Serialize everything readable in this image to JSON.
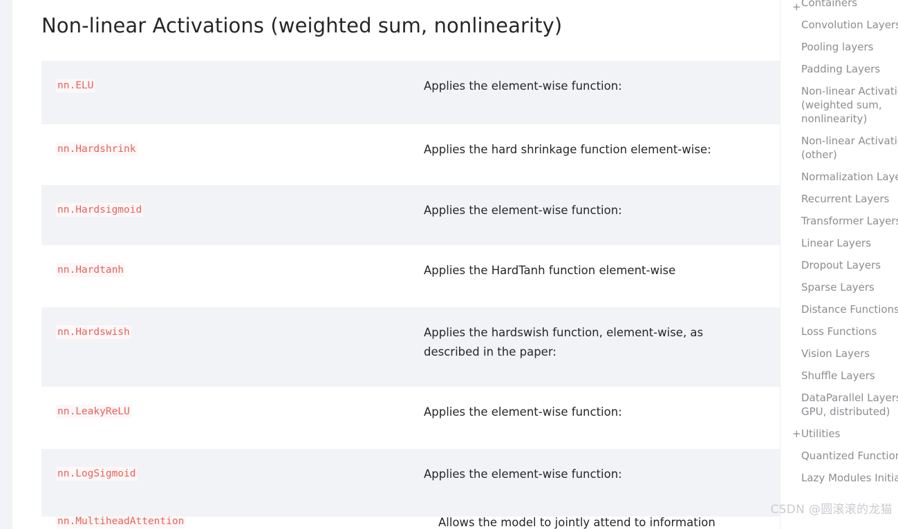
{
  "page": {
    "title": "Non-linear Activations (weighted sum, nonlinearity)",
    "watermark": "CSDN @圆滚滚的龙猫"
  },
  "table": {
    "rows": [
      {
        "name": "nn.ELU",
        "description": "Applies the element-wise function:",
        "shaded": true
      },
      {
        "name": "nn.Hardshrink",
        "description": "Applies the hard shrinkage function element-wise:",
        "shaded": false
      },
      {
        "name": "nn.Hardsigmoid",
        "description": "Applies the element-wise function:",
        "shaded": true
      },
      {
        "name": "nn.Hardtanh",
        "description": "Applies the HardTanh function element-wise",
        "shaded": false
      },
      {
        "name": "nn.Hardswish",
        "description": "Applies the hardswish function, element-wise, as described in the paper:",
        "shaded": true
      },
      {
        "name": "nn.LeakyReLU",
        "description": "Applies the element-wise function:",
        "shaded": false
      },
      {
        "name": "nn.LogSigmoid",
        "description": "Applies the element-wise function:",
        "shaded": true
      }
    ],
    "clipped_row": {
      "name": "nn.MultiheadAttention",
      "description": "Allows the model to jointly attend to information"
    }
  },
  "toc": {
    "items": [
      {
        "label": "Containers",
        "expandable": true
      },
      {
        "label": "Convolution Layers",
        "expandable": false
      },
      {
        "label": "Pooling layers",
        "expandable": false
      },
      {
        "label": "Padding Layers",
        "expandable": false
      },
      {
        "label": "Non-linear Activations (weighted sum, nonlinearity)",
        "expandable": false
      },
      {
        "label": "Non-linear Activations (other)",
        "expandable": false
      },
      {
        "label": "Normalization Layers",
        "expandable": false
      },
      {
        "label": "Recurrent Layers",
        "expandable": false
      },
      {
        "label": "Transformer Layers",
        "expandable": false
      },
      {
        "label": "Linear Layers",
        "expandable": false
      },
      {
        "label": "Dropout Layers",
        "expandable": false
      },
      {
        "label": "Sparse Layers",
        "expandable": false
      },
      {
        "label": "Distance Functions",
        "expandable": false
      },
      {
        "label": "Loss Functions",
        "expandable": false
      },
      {
        "label": "Vision Layers",
        "expandable": false
      },
      {
        "label": "Shuffle Layers",
        "expandable": false
      },
      {
        "label": "DataParallel Layers (multi-GPU, distributed)",
        "expandable": false
      },
      {
        "label": "Utilities",
        "expandable": true
      },
      {
        "label": "Quantized Functions",
        "expandable": false
      },
      {
        "label": "Lazy Modules Initialization",
        "expandable": false
      }
    ],
    "expand_marker": "+"
  },
  "colors": {
    "code_text": "#e8615a",
    "code_background": "#fdf7f7",
    "row_shaded": "#f2f3f7",
    "body_text": "#262626",
    "toc_text": "#8a8d91"
  }
}
